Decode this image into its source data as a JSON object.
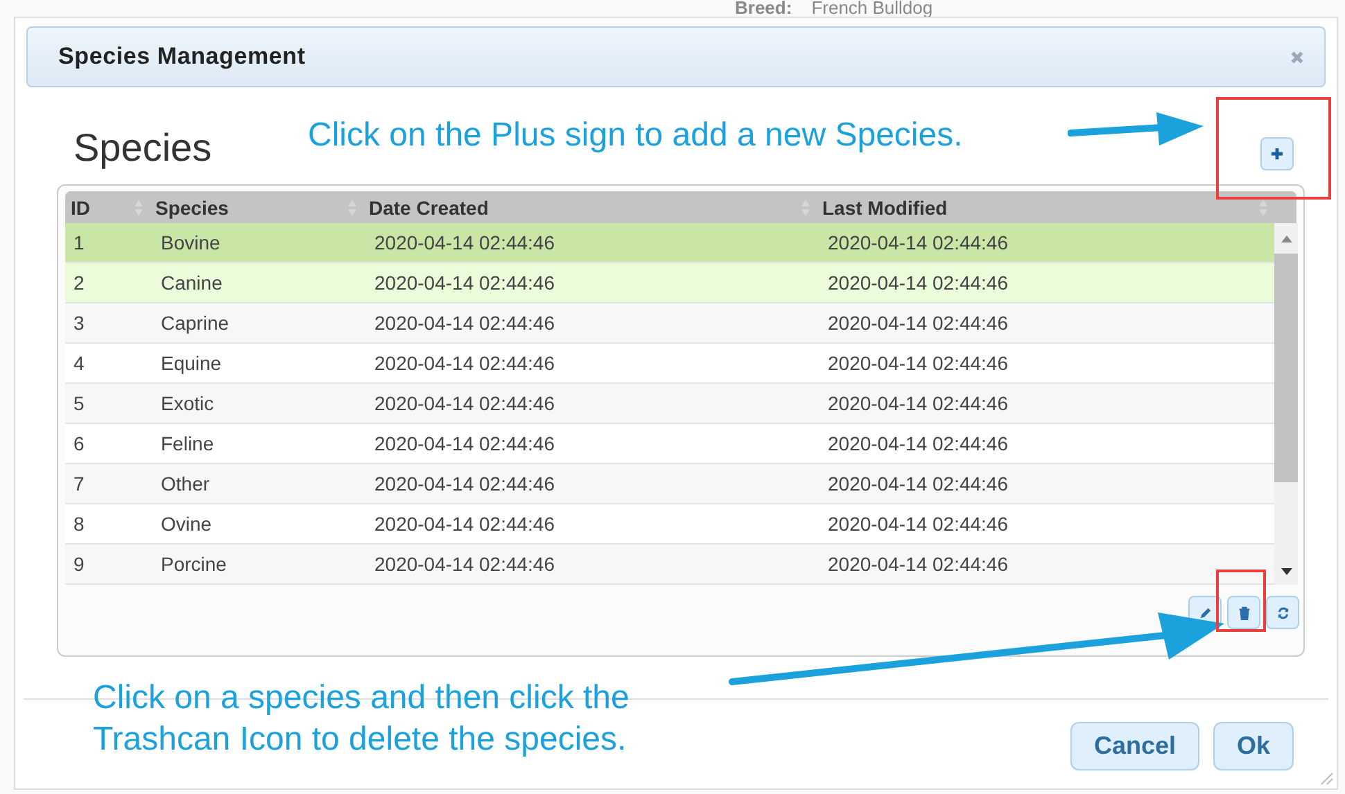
{
  "background": {
    "label": "Breed:",
    "value": "French Bulldog"
  },
  "window": {
    "title": "Species Management"
  },
  "heading": "Species",
  "table": {
    "columns": [
      "ID",
      "Species",
      "Date Created",
      "Last Modified"
    ],
    "rows": [
      {
        "cells": [
          "1",
          "Bovine",
          "2020-04-14 02:44:46",
          "2020-04-14 02:44:46"
        ],
        "selected": true,
        "hovered": false
      },
      {
        "cells": [
          "2",
          "Canine",
          "2020-04-14 02:44:46",
          "2020-04-14 02:44:46"
        ],
        "selected": false,
        "hovered": true
      },
      {
        "cells": [
          "3",
          "Caprine",
          "2020-04-14 02:44:46",
          "2020-04-14 02:44:46"
        ],
        "selected": false,
        "hovered": false
      },
      {
        "cells": [
          "4",
          "Equine",
          "2020-04-14 02:44:46",
          "2020-04-14 02:44:46"
        ],
        "selected": false,
        "hovered": false
      },
      {
        "cells": [
          "5",
          "Exotic",
          "2020-04-14 02:44:46",
          "2020-04-14 02:44:46"
        ],
        "selected": false,
        "hovered": false
      },
      {
        "cells": [
          "6",
          "Feline",
          "2020-04-14 02:44:46",
          "2020-04-14 02:44:46"
        ],
        "selected": false,
        "hovered": false
      },
      {
        "cells": [
          "7",
          "Other",
          "2020-04-14 02:44:46",
          "2020-04-14 02:44:46"
        ],
        "selected": false,
        "hovered": false
      },
      {
        "cells": [
          "8",
          "Ovine",
          "2020-04-14 02:44:46",
          "2020-04-14 02:44:46"
        ],
        "selected": false,
        "hovered": false
      },
      {
        "cells": [
          "9",
          "Porcine",
          "2020-04-14 02:44:46",
          "2020-04-14 02:44:46"
        ],
        "selected": false,
        "hovered": false
      }
    ]
  },
  "buttons": [
    "Cancel",
    "Ok"
  ],
  "annotations": [
    "Click on the Plus sign to add a new Species.",
    "Click on a species and then click the Trashcan Icon to delete the species."
  ]
}
